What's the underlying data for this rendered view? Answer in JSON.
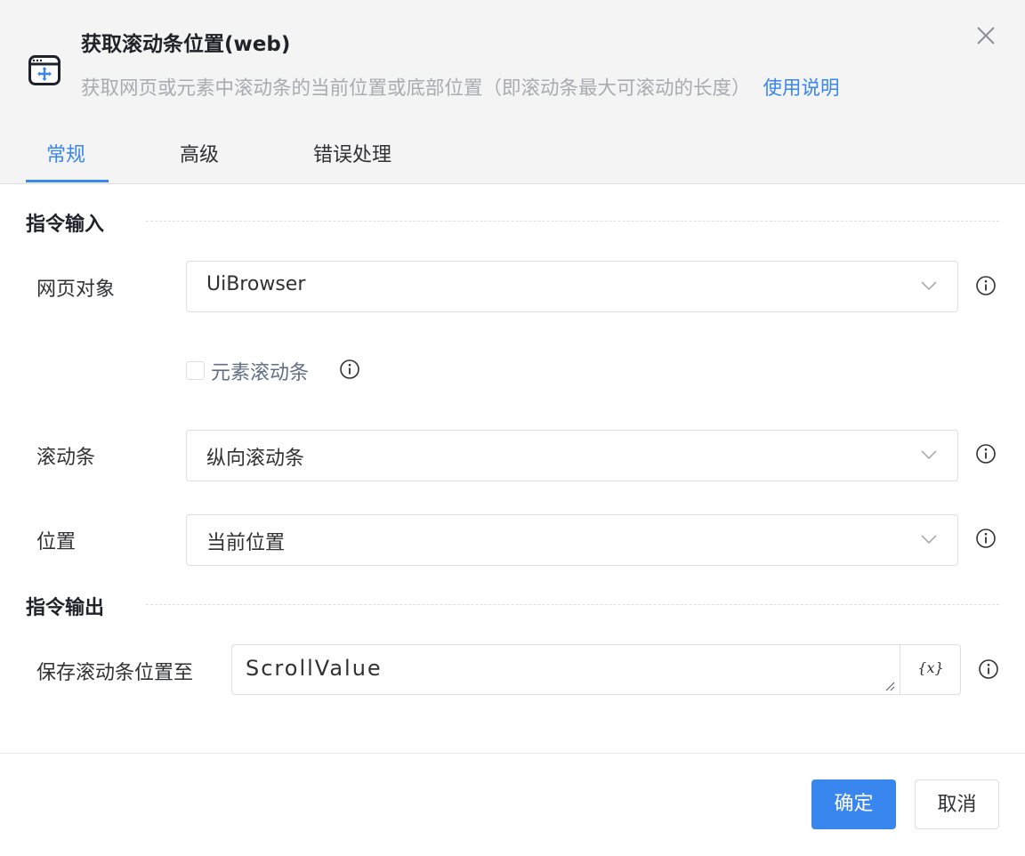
{
  "dialog": {
    "title": "获取滚动条位置(web)",
    "description": "获取网页或元素中滚动条的当前位置或底部位置（即滚动条最大可滚动的长度）",
    "help_link": "使用说明",
    "icons": {
      "app": "browser-window-icon",
      "close": "close-icon"
    }
  },
  "tabs": [
    {
      "label": "常规",
      "active": true
    },
    {
      "label": "高级",
      "active": false
    },
    {
      "label": "错误处理",
      "active": false
    }
  ],
  "input_section": {
    "title": "指令输入",
    "web_object": {
      "label": "网页对象",
      "value": "UiBrowser"
    },
    "element_scroll": {
      "label": "元素滚动条",
      "checked": false
    },
    "scrollbar": {
      "label": "滚动条",
      "value": "纵向滚动条"
    },
    "position": {
      "label": "位置",
      "value": "当前位置"
    }
  },
  "output_section": {
    "title": "指令输出",
    "save_to": {
      "label": "保存滚动条位置至",
      "value": "ScrollValue",
      "var_button": "{x}"
    }
  },
  "footer": {
    "confirm": "确定",
    "cancel": "取消"
  },
  "colors": {
    "accent": "#3a86ef",
    "header_bg": "#f4f4f5",
    "muted_text": "#a8abb2"
  }
}
